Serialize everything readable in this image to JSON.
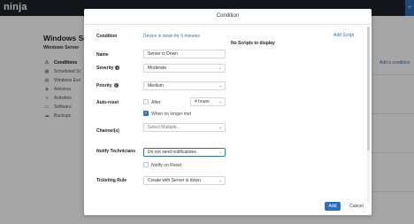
{
  "topbar": {
    "logo_text": "ninja"
  },
  "page": {
    "title": "Windows Ser",
    "subtitle": "Windows Server",
    "nav": [
      {
        "label": "Conditions",
        "icon": "warning-icon",
        "active": true
      },
      {
        "label": "Scheduled Sc",
        "icon": "calendar-icon",
        "active": false
      },
      {
        "label": "Windows Eve",
        "icon": "document-icon",
        "active": false
      },
      {
        "label": "Antivirus",
        "icon": "shield-icon",
        "active": false
      },
      {
        "label": "Activities",
        "icon": "list-icon",
        "active": false
      },
      {
        "label": "Software",
        "icon": "monitor-icon",
        "active": false
      },
      {
        "label": "Backups",
        "icon": "cloud-icon",
        "active": false
      }
    ],
    "add_condition_link": "Add a condition"
  },
  "modal": {
    "title": "Condition",
    "fields": {
      "condition": {
        "label": "Condition",
        "value": "Device is down for 5 minutes"
      },
      "name": {
        "label": "Name",
        "value": "Server is Down"
      },
      "severity": {
        "label": "Severity",
        "value": "Moderate"
      },
      "priority": {
        "label": "Priority",
        "value": "Medium"
      },
      "auto_reset": {
        "label": "Auto-reset",
        "after_label": "After",
        "after_checked": false,
        "hours_value": "4 hours",
        "no_longer_met_label": "When no longer met",
        "no_longer_met_checked": true
      },
      "channels": {
        "label": "Channel(s)",
        "placeholder": "Select Multiple..."
      },
      "notify": {
        "label": "Notify Technicians",
        "value": "Do not send notifications",
        "notify_reset_label": "Notify on Reset",
        "notify_reset_checked": false
      },
      "ticketing": {
        "label": "Ticketing Rule",
        "value": "Create with Server is down"
      }
    },
    "scripts": {
      "add_label": "Add Script",
      "empty_label": "No Scripts to display"
    },
    "footer": {
      "add_label": "Add",
      "cancel_label": "Cancel"
    }
  },
  "colors": {
    "accent": "#2f6fb7",
    "topbar": "#1e2329"
  },
  "icons": {
    "caret": "chevron-down-icon",
    "info": "info-icon",
    "check": "check-icon"
  }
}
